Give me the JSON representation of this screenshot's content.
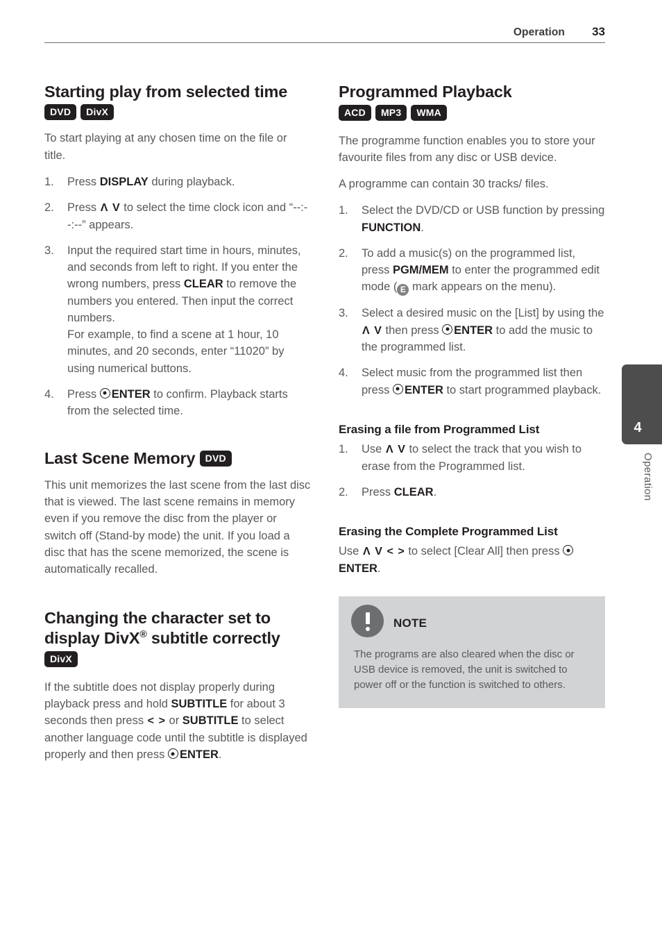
{
  "header": {
    "section": "Operation",
    "page_number": "33"
  },
  "chapter_tab": {
    "number": "4",
    "label": "Operation"
  },
  "left_column": {
    "section1": {
      "title": "Starting play from selected time",
      "badges": [
        "DVD",
        "DivX"
      ],
      "intro": "To start playing at any chosen time on the file or title.",
      "steps": [
        {
          "num": "1.",
          "pre": "Press ",
          "bold": "DISPLAY",
          "post": " during playback."
        },
        {
          "num": "2.",
          "pre": "Press ",
          "arrows": "up-down",
          "post": " to select the time clock icon and “--:--:--” appears."
        },
        {
          "num": "3.",
          "part_a": "Input the required start time in hours, minutes, and seconds from left to right. If you enter the wrong numbers, press ",
          "bold": "CLEAR",
          "part_b": " to remove the numbers you entered. Then input the correct numbers.",
          "part_c": "For example, to find a scene at 1 hour, 10 minutes, and 20 seconds, enter “11020” by using numerical buttons."
        },
        {
          "num": "4.",
          "pre": "Press ",
          "bold": "ENTER",
          "post": " to confirm. Playback starts from the selected time."
        }
      ]
    },
    "section2": {
      "title": "Last Scene Memory",
      "badges": [
        "DVD"
      ],
      "body": "This unit memorizes the last scene from the last disc that is viewed. The last scene remains in memory even if you remove the disc from the player or switch off (Stand-by mode) the unit. If you load a disc that has the scene memorized, the scene is automatically recalled."
    },
    "section3": {
      "title_part1": "Changing the character set to display DivX",
      "title_sup": "®",
      "title_part2": " subtitle correctly",
      "badges": [
        "DivX"
      ],
      "body_a": "If the subtitle does not display properly during playback press and hold ",
      "body_bold1": "SUBTITLE",
      "body_b": " for about 3 seconds then press ",
      "body_arrows": "left-right",
      "body_c": " or ",
      "body_bold2": "SUBTITLE",
      "body_d": " to select another language code until the subtitle is displayed properly and then press ",
      "body_bold3": "ENTER",
      "body_e": "."
    }
  },
  "right_column": {
    "section1": {
      "title": "Programmed Playback",
      "badges": [
        "ACD",
        "MP3",
        "WMA"
      ],
      "intro1": "The programme function enables you to store your favourite files from any disc or USB device.",
      "intro2": "A programme can contain 30 tracks/ files.",
      "steps": [
        {
          "num": "1.",
          "pre": "Select the DVD/CD or USB function by pressing ",
          "bold": "FUNCTION",
          "post": "."
        },
        {
          "num": "2.",
          "pre": "To add a music(s) on the programmed list, press ",
          "bold": "PGM/MEM",
          "mid": " to enter the programmed edit mode (",
          "emark": "E",
          "post": " mark appears on the menu)."
        },
        {
          "num": "3.",
          "pre": "Select a desired music on the [List] by using the ",
          "arrows": "up-down",
          "mid": " then press ",
          "bold": "ENTER",
          "post": " to add the music to the programmed list."
        },
        {
          "num": "4.",
          "pre": "Select music from the programmed list then press ",
          "bold": "ENTER",
          "post": " to start programmed playback."
        }
      ]
    },
    "section2": {
      "title": "Erasing a file from Programmed List",
      "steps": [
        {
          "num": "1.",
          "pre": "Use ",
          "arrows": "up-down",
          "post": " to select the track that you wish to erase from the Programmed list."
        },
        {
          "num": "2.",
          "pre": "Press ",
          "bold": "CLEAR",
          "post": "."
        }
      ]
    },
    "section3": {
      "title": "Erasing the Complete Programmed List",
      "body_a": "Use ",
      "body_arrows_ud": "up-down",
      "body_arrows_lr": "left-right",
      "body_b": " to select [Clear All] then press ",
      "body_bold": "ENTER",
      "body_c": "."
    },
    "note": {
      "title": "NOTE",
      "icon": "exclamation-icon",
      "text": "The programs are also cleared when the disc or USB device is removed, the unit is switched to power off or the function is switched to others."
    }
  },
  "colors": {
    "heading": "#231f20",
    "body": "#58595b",
    "badge_bg": "#231f20",
    "note_bg": "#d1d3d4",
    "note_icon": "#6d6e71",
    "tab_bg": "#4d4d4d",
    "emark_bg": "#808285"
  }
}
